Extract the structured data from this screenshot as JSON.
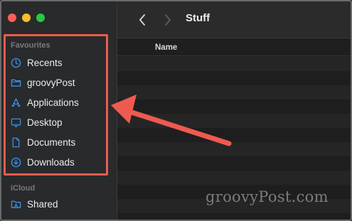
{
  "window": {
    "title": "Stuff",
    "traffic_lights": [
      "#ff5f57",
      "#febc2e",
      "#28c840"
    ]
  },
  "sidebar": {
    "favourites_header": "Favourites",
    "favourites": [
      {
        "label": "Recents",
        "icon": "clock-icon"
      },
      {
        "label": "groovyPost",
        "icon": "folder-icon"
      },
      {
        "label": "Applications",
        "icon": "applications-icon"
      },
      {
        "label": "Desktop",
        "icon": "desktop-icon"
      },
      {
        "label": "Documents",
        "icon": "document-icon"
      },
      {
        "label": "Downloads",
        "icon": "download-icon"
      }
    ],
    "icloud_header": "iCloud",
    "icloud": [
      {
        "label": "Shared",
        "icon": "shared-folder-icon"
      }
    ]
  },
  "main": {
    "column_header": "Name"
  },
  "annotation": {
    "color": "#ee5a4f"
  },
  "watermark": "groovyPost.com",
  "colors": {
    "accent_icon": "#3a8ee6"
  }
}
